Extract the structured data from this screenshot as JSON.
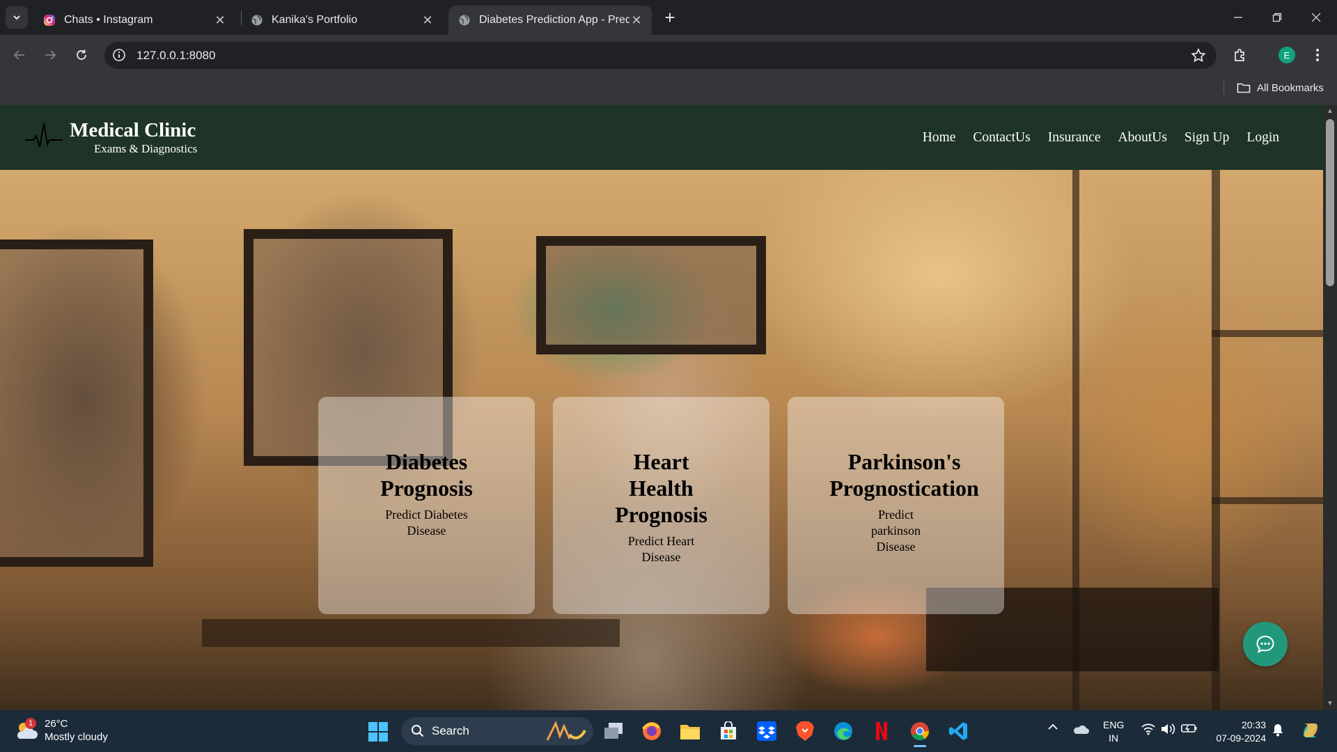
{
  "browser": {
    "tabs": [
      {
        "title": "Chats • Instagram",
        "icon": "instagram-icon"
      },
      {
        "title": "Kanika's Portfolio",
        "icon": "globe-icon"
      },
      {
        "title": "Diabetes Prediction App - Predi",
        "icon": "globe-icon",
        "active": true
      }
    ],
    "url": "127.0.0.1:8080",
    "profile_initial": "E",
    "bookmarks_label": "All Bookmarks"
  },
  "site": {
    "brand": {
      "title": "Medical Clinic",
      "subtitle": "Exams & Diagnostics"
    },
    "nav": [
      "Home",
      "ContactUs",
      "Insurance",
      "AboutUs",
      "Sign Up",
      "Login"
    ],
    "cards": [
      {
        "title": "Diabetes Prognosis",
        "desc": "Predict Diabetes Disease"
      },
      {
        "title": "Heart Health Prognosis",
        "desc": "Predict Heart Disease"
      },
      {
        "title": "Parkinson's Prognostication",
        "desc": "Predict parkinson Disease"
      }
    ]
  },
  "taskbar": {
    "weather": {
      "temp": "26°C",
      "condition": "Mostly cloudy",
      "badge": "1"
    },
    "search_label": "Search",
    "lang": {
      "line1": "ENG",
      "line2": "IN"
    },
    "clock": {
      "time": "20:33",
      "date": "07-09-2024"
    }
  },
  "colors": {
    "header_bg": "#1e3426",
    "chat_fab": "#22987b",
    "card_bg": "rgba(255,255,255,0.38)"
  }
}
